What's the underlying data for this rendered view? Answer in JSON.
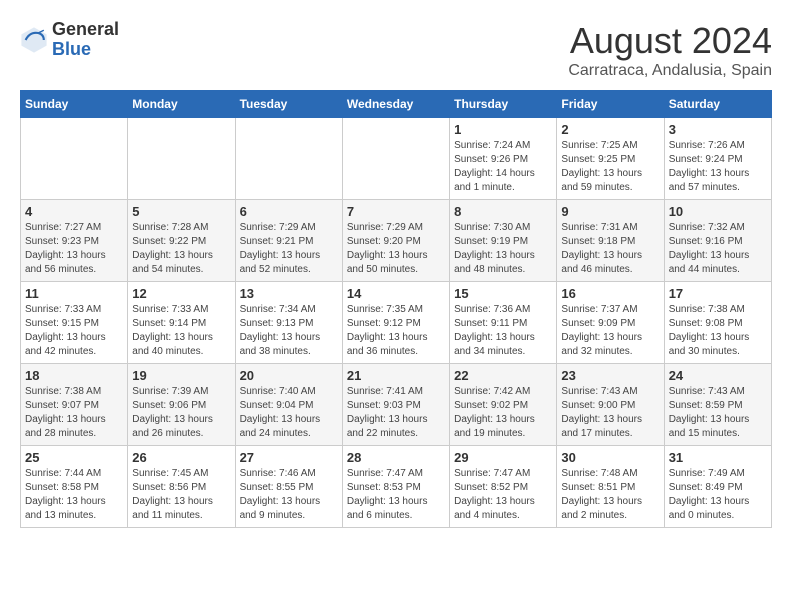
{
  "header": {
    "logo_general": "General",
    "logo_blue": "Blue",
    "month_year": "August 2024",
    "location": "Carratraca, Andalusia, Spain"
  },
  "days_of_week": [
    "Sunday",
    "Monday",
    "Tuesday",
    "Wednesday",
    "Thursday",
    "Friday",
    "Saturday"
  ],
  "weeks": [
    [
      {
        "day": "",
        "info": ""
      },
      {
        "day": "",
        "info": ""
      },
      {
        "day": "",
        "info": ""
      },
      {
        "day": "",
        "info": ""
      },
      {
        "day": "1",
        "info": "Sunrise: 7:24 AM\nSunset: 9:26 PM\nDaylight: 14 hours and 1 minute."
      },
      {
        "day": "2",
        "info": "Sunrise: 7:25 AM\nSunset: 9:25 PM\nDaylight: 13 hours and 59 minutes."
      },
      {
        "day": "3",
        "info": "Sunrise: 7:26 AM\nSunset: 9:24 PM\nDaylight: 13 hours and 57 minutes."
      }
    ],
    [
      {
        "day": "4",
        "info": "Sunrise: 7:27 AM\nSunset: 9:23 PM\nDaylight: 13 hours and 56 minutes."
      },
      {
        "day": "5",
        "info": "Sunrise: 7:28 AM\nSunset: 9:22 PM\nDaylight: 13 hours and 54 minutes."
      },
      {
        "day": "6",
        "info": "Sunrise: 7:29 AM\nSunset: 9:21 PM\nDaylight: 13 hours and 52 minutes."
      },
      {
        "day": "7",
        "info": "Sunrise: 7:29 AM\nSunset: 9:20 PM\nDaylight: 13 hours and 50 minutes."
      },
      {
        "day": "8",
        "info": "Sunrise: 7:30 AM\nSunset: 9:19 PM\nDaylight: 13 hours and 48 minutes."
      },
      {
        "day": "9",
        "info": "Sunrise: 7:31 AM\nSunset: 9:18 PM\nDaylight: 13 hours and 46 minutes."
      },
      {
        "day": "10",
        "info": "Sunrise: 7:32 AM\nSunset: 9:16 PM\nDaylight: 13 hours and 44 minutes."
      }
    ],
    [
      {
        "day": "11",
        "info": "Sunrise: 7:33 AM\nSunset: 9:15 PM\nDaylight: 13 hours and 42 minutes."
      },
      {
        "day": "12",
        "info": "Sunrise: 7:33 AM\nSunset: 9:14 PM\nDaylight: 13 hours and 40 minutes."
      },
      {
        "day": "13",
        "info": "Sunrise: 7:34 AM\nSunset: 9:13 PM\nDaylight: 13 hours and 38 minutes."
      },
      {
        "day": "14",
        "info": "Sunrise: 7:35 AM\nSunset: 9:12 PM\nDaylight: 13 hours and 36 minutes."
      },
      {
        "day": "15",
        "info": "Sunrise: 7:36 AM\nSunset: 9:11 PM\nDaylight: 13 hours and 34 minutes."
      },
      {
        "day": "16",
        "info": "Sunrise: 7:37 AM\nSunset: 9:09 PM\nDaylight: 13 hours and 32 minutes."
      },
      {
        "day": "17",
        "info": "Sunrise: 7:38 AM\nSunset: 9:08 PM\nDaylight: 13 hours and 30 minutes."
      }
    ],
    [
      {
        "day": "18",
        "info": "Sunrise: 7:38 AM\nSunset: 9:07 PM\nDaylight: 13 hours and 28 minutes."
      },
      {
        "day": "19",
        "info": "Sunrise: 7:39 AM\nSunset: 9:06 PM\nDaylight: 13 hours and 26 minutes."
      },
      {
        "day": "20",
        "info": "Sunrise: 7:40 AM\nSunset: 9:04 PM\nDaylight: 13 hours and 24 minutes."
      },
      {
        "day": "21",
        "info": "Sunrise: 7:41 AM\nSunset: 9:03 PM\nDaylight: 13 hours and 22 minutes."
      },
      {
        "day": "22",
        "info": "Sunrise: 7:42 AM\nSunset: 9:02 PM\nDaylight: 13 hours and 19 minutes."
      },
      {
        "day": "23",
        "info": "Sunrise: 7:43 AM\nSunset: 9:00 PM\nDaylight: 13 hours and 17 minutes."
      },
      {
        "day": "24",
        "info": "Sunrise: 7:43 AM\nSunset: 8:59 PM\nDaylight: 13 hours and 15 minutes."
      }
    ],
    [
      {
        "day": "25",
        "info": "Sunrise: 7:44 AM\nSunset: 8:58 PM\nDaylight: 13 hours and 13 minutes."
      },
      {
        "day": "26",
        "info": "Sunrise: 7:45 AM\nSunset: 8:56 PM\nDaylight: 13 hours and 11 minutes."
      },
      {
        "day": "27",
        "info": "Sunrise: 7:46 AM\nSunset: 8:55 PM\nDaylight: 13 hours and 9 minutes."
      },
      {
        "day": "28",
        "info": "Sunrise: 7:47 AM\nSunset: 8:53 PM\nDaylight: 13 hours and 6 minutes."
      },
      {
        "day": "29",
        "info": "Sunrise: 7:47 AM\nSunset: 8:52 PM\nDaylight: 13 hours and 4 minutes."
      },
      {
        "day": "30",
        "info": "Sunrise: 7:48 AM\nSunset: 8:51 PM\nDaylight: 13 hours and 2 minutes."
      },
      {
        "day": "31",
        "info": "Sunrise: 7:49 AM\nSunset: 8:49 PM\nDaylight: 13 hours and 0 minutes."
      }
    ]
  ]
}
